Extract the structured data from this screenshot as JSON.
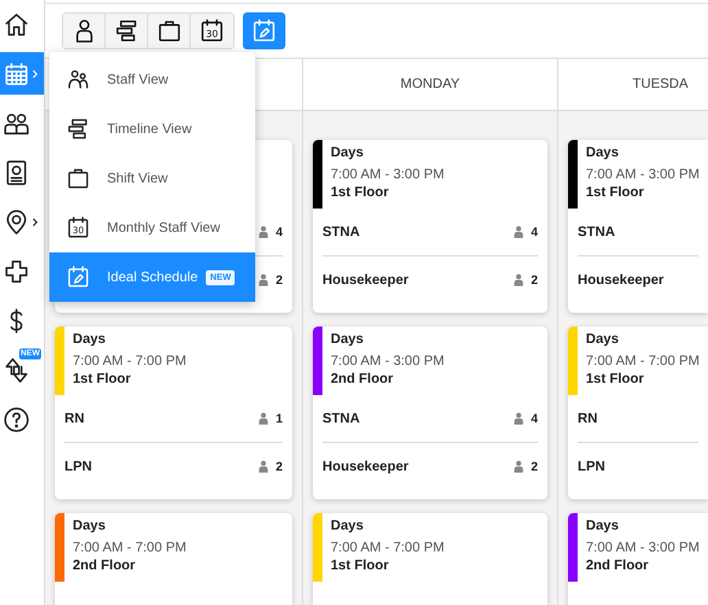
{
  "sidebar": {
    "items": [
      {
        "kind": "home",
        "selected": false,
        "submenu": false
      },
      {
        "kind": "calendar",
        "selected": true,
        "submenu": true
      },
      {
        "kind": "people",
        "selected": false,
        "submenu": false
      },
      {
        "kind": "badge",
        "selected": false,
        "submenu": false
      },
      {
        "kind": "pin",
        "selected": false,
        "submenu": true
      },
      {
        "kind": "plus",
        "selected": false,
        "submenu": false
      },
      {
        "kind": "dollar",
        "selected": false,
        "submenu": false
      },
      {
        "kind": "swap",
        "selected": false,
        "submenu": false,
        "badge": "NEW"
      },
      {
        "kind": "help",
        "selected": false,
        "submenu": false
      }
    ]
  },
  "toolbar": {
    "buttons": [
      {
        "kind": "staff",
        "selected": false
      },
      {
        "kind": "timeline",
        "selected": false
      },
      {
        "kind": "shift",
        "selected": false
      },
      {
        "kind": "monthly",
        "icon_text": "30",
        "selected": false
      },
      {
        "kind": "ideal",
        "selected": true
      }
    ]
  },
  "view_menu": {
    "items": [
      {
        "kind": "staff",
        "label": "Staff View",
        "selected": false
      },
      {
        "kind": "timeline",
        "label": "Timeline View",
        "selected": false
      },
      {
        "kind": "shift",
        "label": "Shift View",
        "selected": false
      },
      {
        "kind": "monthly",
        "icon_text": "30",
        "label": "Monthly Staff View",
        "selected": false
      },
      {
        "kind": "ideal",
        "label": "Ideal Schedule",
        "badge": "NEW",
        "selected": true
      }
    ]
  },
  "schedule": {
    "columns": [
      {
        "cards": [
          {
            "roles": [
              {
                "count": "4"
              },
              {
                "count": "2"
              }
            ]
          },
          {
            "color": "#ffd600",
            "shift": "Days",
            "time": "7:00 AM - 7:00 PM",
            "location": "1st Floor",
            "roles": [
              {
                "role": "RN",
                "count": "1"
              },
              {
                "role": "LPN",
                "count": "2"
              }
            ]
          },
          {
            "color": "#ff6a00",
            "shift": "Days",
            "time": "7:00 AM - 7:00 PM",
            "location": "2nd Floor"
          }
        ]
      },
      {
        "day": "MONDAY",
        "cards": [
          {
            "color": "#000000",
            "shift": "Days",
            "time": "7:00 AM - 3:00 PM",
            "location": "1st Floor",
            "roles": [
              {
                "role": "STNA",
                "count": "4"
              },
              {
                "role": "Housekeeper",
                "count": "2"
              }
            ]
          },
          {
            "color": "#8a00ff",
            "shift": "Days",
            "time": "7:00 AM - 3:00 PM",
            "location": "2nd Floor",
            "roles": [
              {
                "role": "STNA",
                "count": "4"
              },
              {
                "role": "Housekeeper",
                "count": "2"
              }
            ]
          },
          {
            "color": "#ffd600",
            "shift": "Days",
            "time": "7:00 AM - 7:00 PM",
            "location": "1st Floor"
          }
        ]
      },
      {
        "day": "TUESDA",
        "cards": [
          {
            "color": "#000000",
            "shift": "Days",
            "time": "7:00 AM - 3:00 PM",
            "location": "1st Floor",
            "roles": [
              {
                "role": "STNA"
              },
              {
                "role": "Housekeeper"
              }
            ]
          },
          {
            "color": "#ffd600",
            "shift": "Days",
            "time": "7:00 AM - 7:00 PM",
            "location": "1st Floor",
            "roles": [
              {
                "role": "RN"
              },
              {
                "role": "LPN"
              }
            ]
          },
          {
            "color": "#8a00ff",
            "shift": "Days",
            "time": "7:00 AM - 3:00 PM",
            "location": "2nd Floor"
          }
        ]
      }
    ]
  }
}
